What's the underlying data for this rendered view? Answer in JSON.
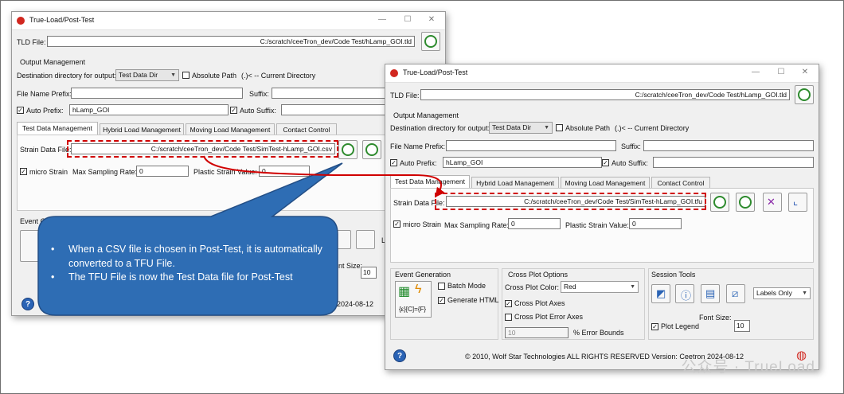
{
  "back_window": {
    "title": "True-Load/Post-Test",
    "tld_label": "TLD File:",
    "tld_value": "C:/scratch/ceeTron_dev/Code Test/hLamp_GOI.tld",
    "output_mgmt": "Output Management",
    "dest_label": "Destination directory for output:",
    "dest_value": "Test Data Dir",
    "absolute_path": "Absolute Path",
    "current_dir": "(.)< -- Current Directory",
    "prefix_label": "File Name Prefix:",
    "suffix_label": "Suffix:",
    "auto_prefix": "Auto Prefix:",
    "auto_prefix_value": "hLamp_GOI",
    "auto_suffix": "Auto Suffix:",
    "tabs": [
      "Test Data Management",
      "Hybrid Load Management",
      "Moving Load Management",
      "Contact Control"
    ],
    "strain_label": "Strain Data File:",
    "strain_value": "C:/scratch/ceeTron_dev/Code Test/SimTest-hLamp_GOI.csv",
    "micro_strain": "micro Strain",
    "max_sampling": "Max Sampling Rate:",
    "max_sampling_value": "0",
    "plastic": "Plastic Strain Value:",
    "plastic_value": "0",
    "event_gen": "Event G",
    "font_size": "nt Size:",
    "font_size_value": "10",
    "footer_date": "2024-08-12",
    "labels_stub": "La"
  },
  "front_window": {
    "title": "True-Load/Post-Test",
    "tld_label": "TLD File:",
    "tld_value": "C:/scratch/ceeTron_dev/Code Test/hLamp_GOI.tld",
    "output_mgmt": "Output Management",
    "dest_label": "Destination directory for output:",
    "dest_value": "Test Data Dir",
    "absolute_path": "Absolute Path",
    "current_dir": "(.)< -- Current Directory",
    "prefix_label": "File Name Prefix:",
    "suffix_label": "Suffix:",
    "auto_prefix": "Auto Prefix:",
    "auto_prefix_value": "hLamp_GOI",
    "auto_suffix": "Auto Suffix:",
    "tabs": [
      "Test Data Management",
      "Hybrid Load Management",
      "Moving Load Management",
      "Contact Control"
    ],
    "strain_label": "Strain Data File:",
    "strain_value": "C:/scratch/ceeTron_dev/Code Test/SimTest-hLamp_GOI.tfu",
    "micro_strain": "micro Strain",
    "max_sampling": "Max Sampling Rate:",
    "max_sampling_value": "0",
    "plastic": "Plastic Strain Value:",
    "plastic_value": "0",
    "event_gen": {
      "title": "Event Generation",
      "batch_mode": "Batch Mode",
      "generate_html": "Generate HTML"
    },
    "cross_plot": {
      "title": "Cross Plot Options",
      "color_label": "Cross Plot Color:",
      "color_value": "Red",
      "axes": "Cross Plot Axes",
      "error_axes": "Cross Plot Error Axes",
      "error_bounds_value": "10",
      "error_bounds_label": "% Error Bounds"
    },
    "session": {
      "title": "Session Tools",
      "labels_value": "Labels Only",
      "font_size_label": "Font Size:",
      "plot_legend": "Plot Legend",
      "font_size_value": "10"
    },
    "footer": "© 2010, Wolf Star Technologies  ALL RIGHTS RESERVED    Version:  Ceetron 2024-08-12"
  },
  "callout": {
    "bullets": [
      "When a CSV file is chosen in Post-Test, it is automatically converted to a TFU File.",
      "The TFU File is now the Test Data file for Post-Test"
    ]
  },
  "watermark": "公众号 · TrueLoad",
  "colors": {
    "callout_fill": "#2e6db4",
    "callout_border": "#244f86",
    "highlight_red": "#d00000",
    "title_icon_red": "#d1271f",
    "reload_green": "#2e8b2e"
  }
}
